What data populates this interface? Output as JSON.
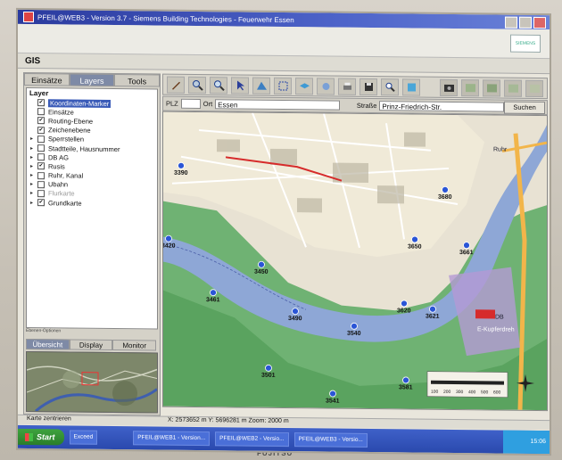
{
  "window": {
    "title": "PFEIL@WEB3 - Version 3.7 - Siemens Building Technologies - Feuerwehr Essen"
  },
  "header": {
    "logo_text": "SIEMENS"
  },
  "gis_label": "GIS",
  "left_tabs": [
    {
      "label": "Einsätze"
    },
    {
      "label": "Layers"
    },
    {
      "label": "Tools"
    }
  ],
  "layers": {
    "heading": "Layer",
    "items": [
      {
        "label": "Koordinaten-Marker",
        "checked": true,
        "expandable": false
      },
      {
        "label": "Einsätze",
        "checked": false,
        "expandable": false
      },
      {
        "label": "Routing-Ebene",
        "checked": true,
        "expandable": false
      },
      {
        "label": "Zeichenebene",
        "checked": true,
        "expandable": false
      },
      {
        "label": "Sperrstellen",
        "checked": false,
        "expandable": true
      },
      {
        "label": "Stadtteile, Hausnummer",
        "checked": false,
        "expandable": true
      },
      {
        "label": "DB AG",
        "checked": false,
        "expandable": true
      },
      {
        "label": "Rusis",
        "checked": true,
        "expandable": true
      },
      {
        "label": "Ruhr, Kanal",
        "checked": false,
        "expandable": true
      },
      {
        "label": "Ubahn",
        "checked": false,
        "expandable": true
      },
      {
        "label": "Flurkarte",
        "checked": false,
        "expandable": true
      },
      {
        "label": "Grundkarte",
        "checked": true,
        "expandable": true
      }
    ],
    "footer": "Ebenen-Optionen"
  },
  "sub_tabs": [
    {
      "label": "Übersicht"
    },
    {
      "label": "Display"
    },
    {
      "label": "Monitor"
    }
  ],
  "search": {
    "plz_label": "PLZ",
    "ort_label": "Ort",
    "ort_value": "Essen",
    "strasse_label": "Straße",
    "strasse_value": "Prinz-Friedrich-Str.",
    "search_button": "Suchen"
  },
  "map": {
    "markers": [
      "3390",
      "3420",
      "3450",
      "3461",
      "3490",
      "3501",
      "3540",
      "3541",
      "3581",
      "3620",
      "3621",
      "3650",
      "3661",
      "3680"
    ],
    "labels": [
      "Ruhr",
      "E-Kupferdreh",
      "DB",
      "Kl"
    ],
    "scale": [
      "100",
      "200",
      "300",
      "400",
      "500",
      "600"
    ]
  },
  "status": {
    "hint": "Karte zentrieren",
    "coords": "X: 2573652 m  Y: 5696281 m  Zoom: 2000 m"
  },
  "taskbar": {
    "start": "Start",
    "tasks": [
      "Exceed",
      "PFEIL@WEB1 - Version...",
      "PFEIL@WEB2 - Versio...",
      "PFEIL@WEB3 - Versio..."
    ],
    "clock": "15:06"
  },
  "brand": "FUJITSU",
  "colors": {
    "title_bar": "#2a3a9e",
    "tab_active": "#7e8aa6",
    "taskbar": "#2a49ad",
    "start_button": "#3fa33f",
    "marker": "#2a55d6"
  }
}
